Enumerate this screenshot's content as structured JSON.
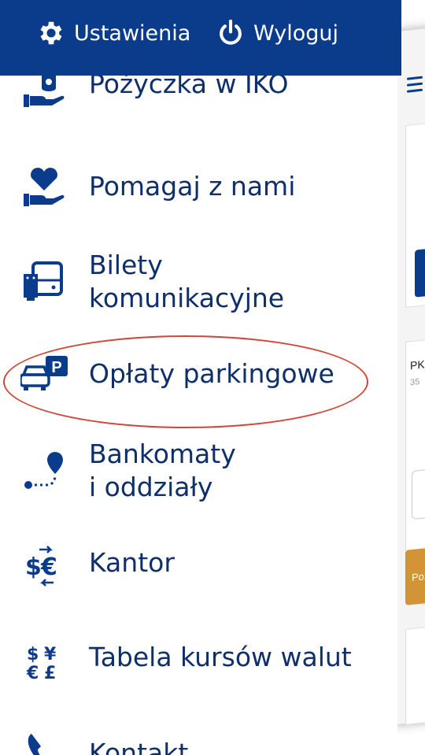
{
  "topbar": {
    "settings_label": "Ustawienia",
    "logout_label": "Wyloguj",
    "settings_icon": "gear-icon",
    "logout_icon": "power-icon",
    "bg_color": "#0b3c8c"
  },
  "menu": {
    "items": [
      {
        "label": "Pożyczka w IKO",
        "icon": "loan-coins-hand-icon"
      },
      {
        "label": "Pomagaj z nami",
        "icon": "heart-hand-icon"
      },
      {
        "label_line1": "Bilety",
        "label_line2": "komunikacyjne",
        "icon": "bus-ticket-icon"
      },
      {
        "label": "Opłaty parkingowe",
        "icon": "car-parking-icon"
      },
      {
        "label_line1": "Bankomaty",
        "label_line2": "i oddziały",
        "icon": "map-pin-route-icon"
      },
      {
        "label": "Kantor",
        "icon": "currency-exchange-icon"
      },
      {
        "label": "Tabela kursów walut",
        "icon": "currency-table-icon"
      },
      {
        "label": "Kontakt",
        "icon": "phone-icon"
      }
    ],
    "text_color": "#0f2f6a",
    "highlight_color": "#d24536"
  },
  "background_app": {
    "text1": "PKO",
    "text2": "35",
    "button_text": "Poż",
    "accent_orange": "#d39435"
  }
}
